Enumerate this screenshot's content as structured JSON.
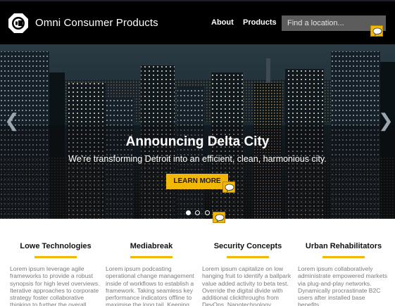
{
  "header": {
    "brand": "Omni Consumer Products",
    "nav": [
      {
        "label": "About"
      },
      {
        "label": "Products"
      }
    ],
    "search_placeholder": "Find a location..."
  },
  "hero": {
    "title": "Announcing Delta City",
    "subtitle": "We're transforming Detroit into an efficient, clean, harmonious city.",
    "button_label": "LEARN MORE",
    "slide_count": 3,
    "active_slide": 1
  },
  "features": [
    {
      "title": "Lowe Technologies",
      "text": "Lorem ipsum leverage agile frameworks to provide a robust synopsis for high level overviews. Iterative approaches to corporate strategy foster collaborative thinking to further the overall"
    },
    {
      "title": "Mediabreak",
      "text": "Lorem ipsum podcasting operational change management inside of workflows to establish a framework. Taking seamless key performance indicators offline to maximise the long tail. Keeping"
    },
    {
      "title": "Security Concepts",
      "text": "Lorem ipsum capitalize on low hanging fruit to identify a ballpark value added activity to beta test. Override the digital divide with additional clickthroughs from DevOps. Nanotechnology"
    },
    {
      "title": "Urban Rehabilitators",
      "text": "Lorem ipsum collaboratively administrate empowered markets via plug-and-play networks. Dynamically procrastinate B2C users after installed base benefits."
    }
  ],
  "colors": {
    "accent": "#f2b807",
    "navbar": "#000000",
    "search_bg": "#5c5c5c"
  },
  "icons": {
    "logo": "ocp-logo-icon",
    "chat": "chat-bubble-icon",
    "prev": "chevron-left-icon",
    "next": "chevron-right-icon"
  }
}
